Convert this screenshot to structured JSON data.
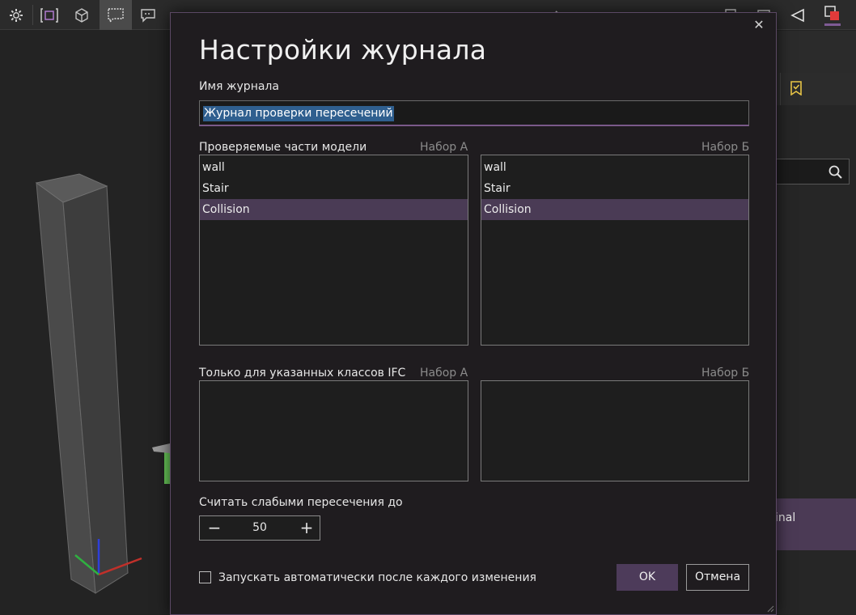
{
  "toolbar": {
    "icons": [
      "gear-icon",
      "frame-select-icon",
      "cube-icon",
      "comment-icon",
      "comment-alt-icon",
      "flag-icon",
      "box-icon",
      "transform-icon",
      "pen-icon",
      "trash-icon",
      "camera-icon",
      "axis-icon"
    ],
    "active_index": 3,
    "right_icons": [
      "chevron-right-icon",
      "doc-icon",
      "window-icon",
      "triangle-left-icon",
      "color-fill-icon"
    ]
  },
  "right_panel": {
    "partial_item_label": "inal",
    "accent_color": "#e8c547"
  },
  "dialog": {
    "title": "Настройки журнала",
    "name_label": "Имя журнала",
    "name_value": "Журнал проверки пересечений",
    "parts_label": "Проверяемые части модели",
    "set_a_label": "Набор А",
    "set_b_label": "Набор Б",
    "set_a_items": [
      "wall",
      "Stair",
      "Collision"
    ],
    "set_b_items": [
      "wall",
      "Stair",
      "Collision"
    ],
    "selected_item": "Collision",
    "ifc_label": "Только для указанных классов IFC",
    "ifc_set_a_label": "Набор А",
    "ifc_set_b_label": "Набор Б",
    "weak_label": "Считать слабыми пересечения до",
    "weak_value": "50",
    "minus_symbol": "−",
    "plus_symbol": "+",
    "auto_run_label": "Запускать автоматически после каждого изменения",
    "auto_run_checked": false,
    "ok_label": "OK",
    "cancel_label": "Отмена",
    "close_symbol": "✕"
  },
  "colors": {
    "accent": "#4d3b5a",
    "selection": "#4a3b55",
    "text_selection": "#2f5f8f"
  }
}
